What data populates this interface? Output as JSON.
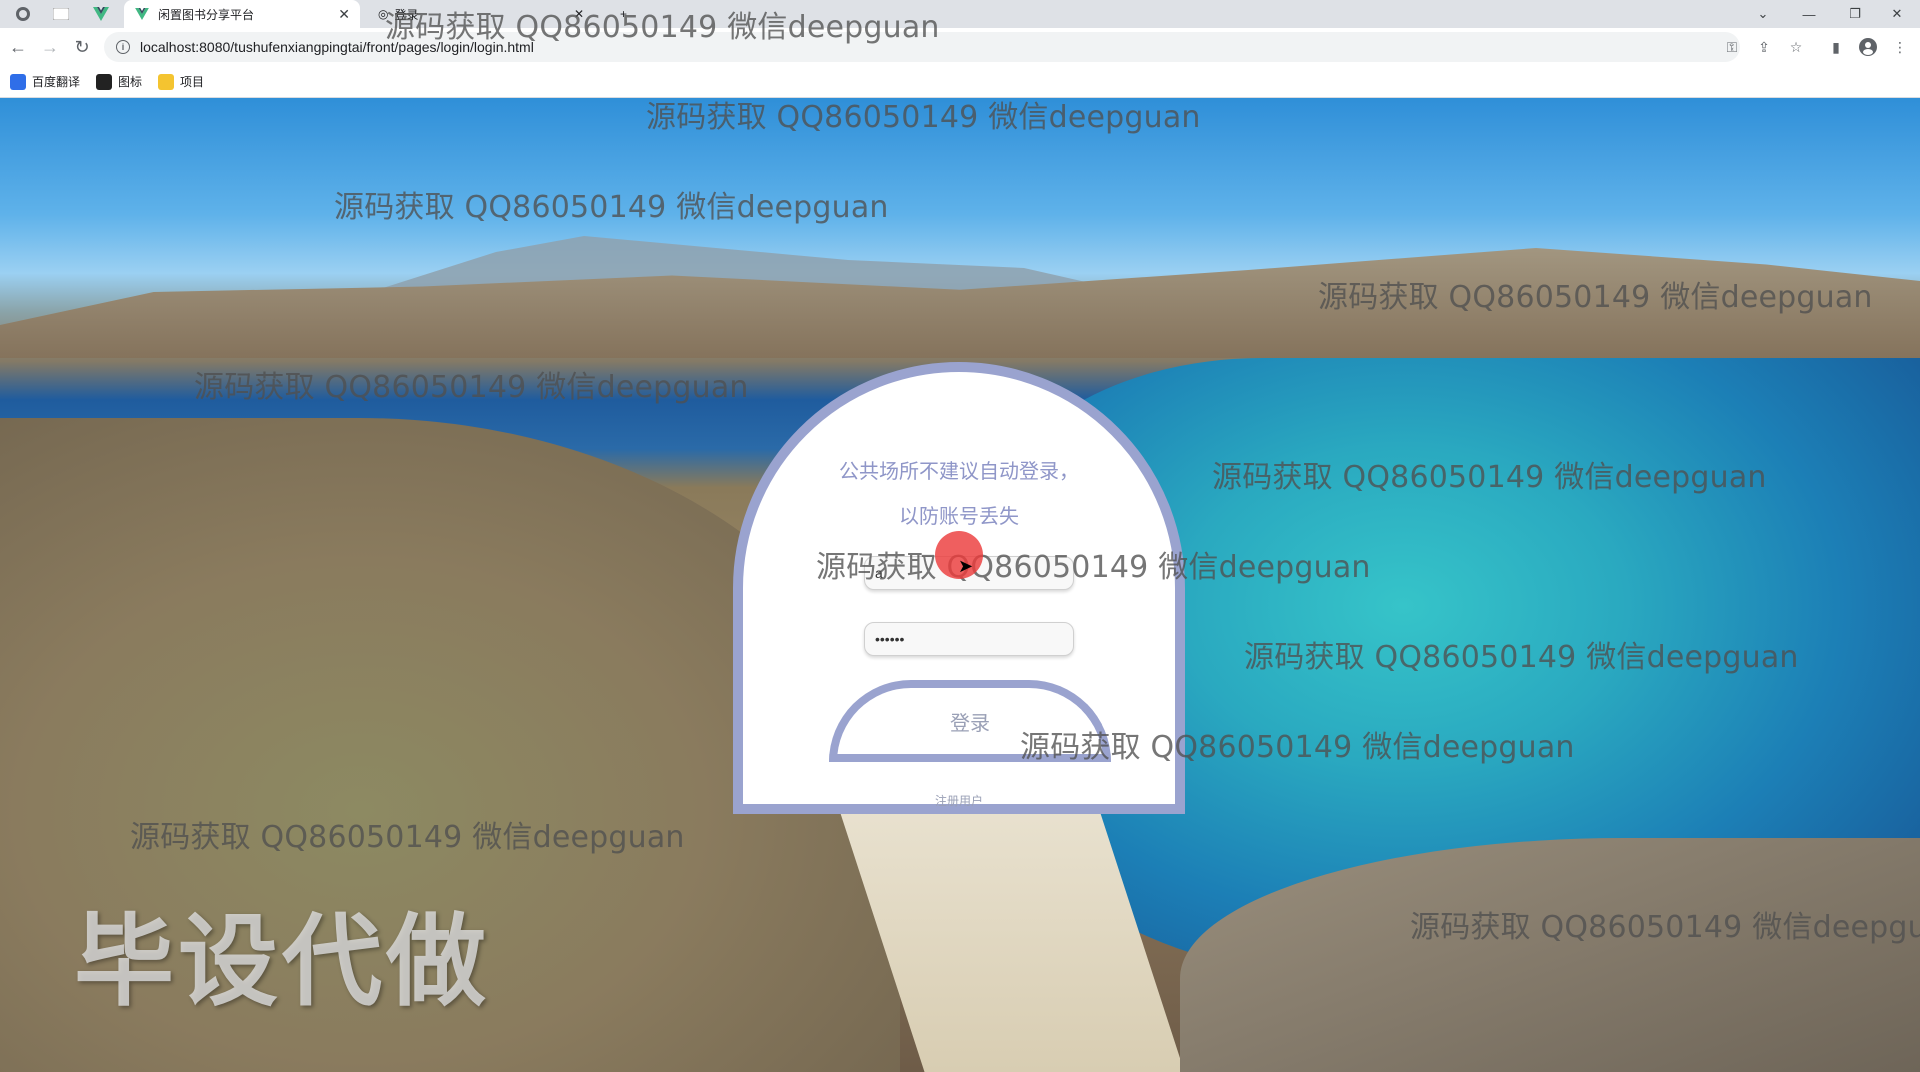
{
  "browser": {
    "tabs": [
      {
        "title": "闲置图书分享平台",
        "active": true
      },
      {
        "title": "登录",
        "active": false
      }
    ],
    "new_tab_label": "+",
    "url": "localhost:8080/tushufenxiangpingtai/front/pages/login/login.html",
    "bookmarks": [
      {
        "label": "百度翻译",
        "icon": "translate-icon",
        "color": "#2f6ee8"
      },
      {
        "label": "图标",
        "icon": "image-icon",
        "color": "#222222"
      },
      {
        "label": "项目",
        "icon": "folder-icon",
        "color": "#f4c430"
      }
    ]
  },
  "watermark_text": "源码获取 QQ86050149 微信deepguan",
  "badge_text": "毕设代做",
  "login": {
    "hint": "公共场所不建议自动登录，以防账号丢失",
    "username_value": "a",
    "password_value": "••••••",
    "login_label": "登录",
    "register_label": "注册用户"
  },
  "colors": {
    "accent": "#9aa3cf",
    "hint_text": "#8f96c8"
  }
}
